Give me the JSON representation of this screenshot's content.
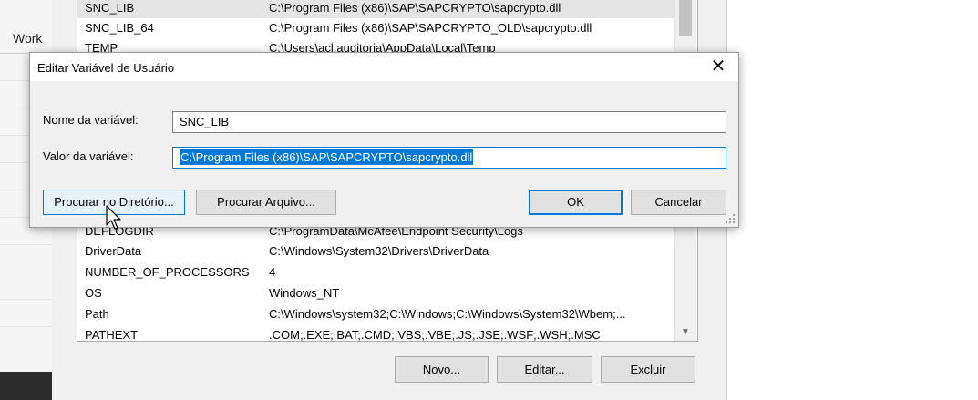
{
  "left_app": {
    "tab_label": "Work"
  },
  "background_window": {
    "variables": [
      {
        "name": "SNC_LIB",
        "value": "C:\\Program Files (x86)\\SAP\\SAPCRYPTO\\sapcrypto.dll",
        "selected": true
      },
      {
        "name": "SNC_LIB_64",
        "value": "C:\\Program Files (x86)\\SAP\\SAPCRYPTO_OLD\\sapcrypto.dll"
      },
      {
        "name": "TEMP",
        "value": "C:\\Users\\acl.auditoria\\AppData\\Local\\Temp"
      }
    ],
    "system_variables": [
      {
        "name": "DEFLOGDIR",
        "value": "C:\\ProgramData\\McAfee\\Endpoint Security\\Logs"
      },
      {
        "name": "DriverData",
        "value": "C:\\Windows\\System32\\Drivers\\DriverData"
      },
      {
        "name": "NUMBER_OF_PROCESSORS",
        "value": "4"
      },
      {
        "name": "OS",
        "value": "Windows_NT"
      },
      {
        "name": "Path",
        "value": "C:\\Windows\\system32;C:\\Windows;C:\\Windows\\System32\\Wbem;..."
      },
      {
        "name": "PATHEXT",
        "value": ".COM;.EXE;.BAT;.CMD;.VBS;.VBE;.JS;.JSE;.WSF;.WSH;.MSC"
      }
    ],
    "buttons": {
      "new": "Novo...",
      "edit": "Editar...",
      "delete": "Excluir"
    }
  },
  "dialog": {
    "title": "Editar Variável de Usuário",
    "name_label": "Nome da variável:",
    "name_value": "SNC_LIB",
    "value_label": "Valor da variável:",
    "value_value": "C:\\Program Files (x86)\\SAP\\SAPCRYPTO\\sapcrypto.dll",
    "browse_directory_button": "Procurar no Diretório...",
    "browse_file_button": "Procurar Arquivo...",
    "ok_button": "OK",
    "cancel_button": "Cancelar",
    "close_icon": "close-icon"
  }
}
